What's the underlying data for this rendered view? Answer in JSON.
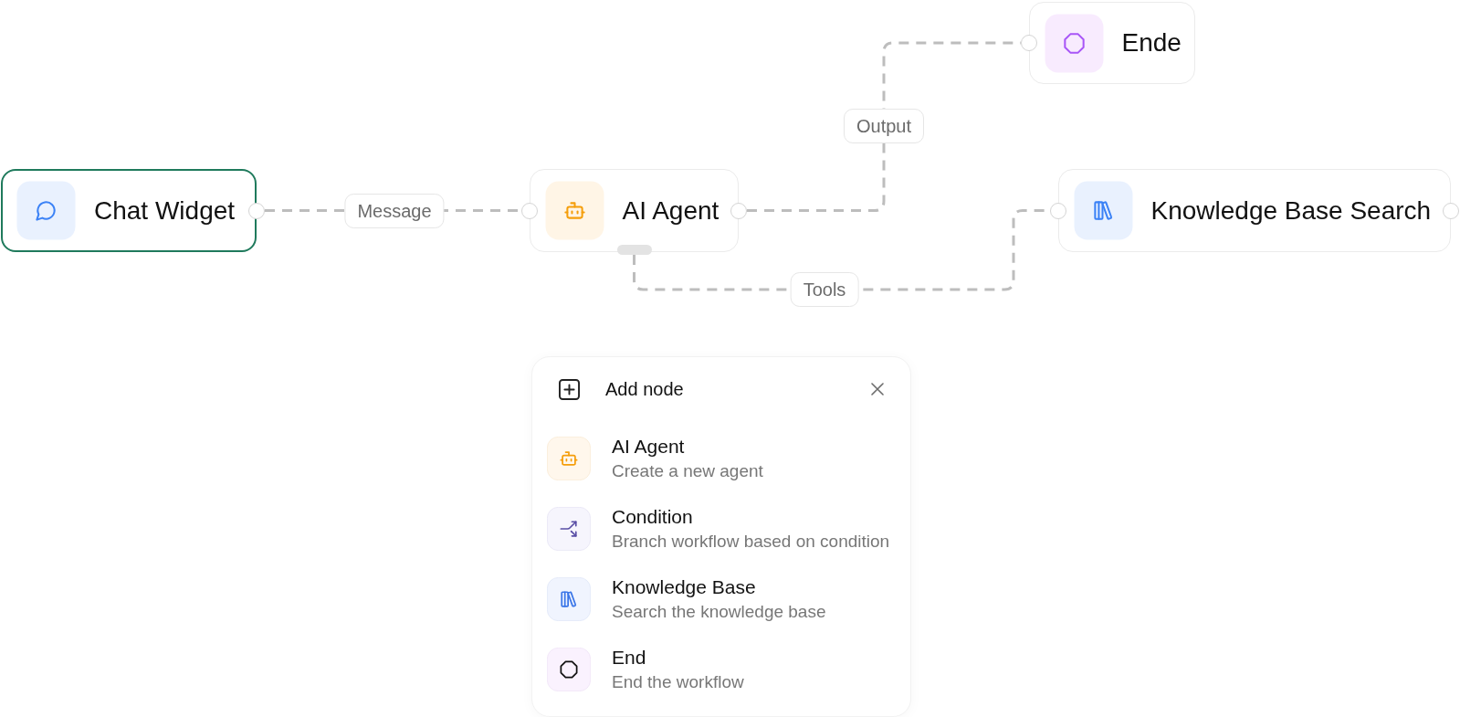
{
  "canvas": {
    "nodes": [
      {
        "kind": "chat",
        "label": "Chat Widget",
        "selected": true
      },
      {
        "kind": "agent",
        "label": "AI Agent",
        "selected": false
      },
      {
        "kind": "end",
        "label": "Ende",
        "selected": false
      },
      {
        "kind": "knowledge",
        "label": "Knowledge Base Search",
        "selected": false
      }
    ],
    "edges": [
      {
        "label": "Message"
      },
      {
        "label": "Output"
      },
      {
        "label": "Tools"
      }
    ]
  },
  "add_node_panel": {
    "title": "Add node",
    "items": [
      {
        "kind": "agent",
        "title": "AI Agent",
        "description": "Create a new agent"
      },
      {
        "kind": "condition",
        "title": "Condition",
        "description": "Branch workflow based on condition"
      },
      {
        "kind": "knowledge",
        "title": "Knowledge Base",
        "description": "Search the knowledge base"
      },
      {
        "kind": "end",
        "title": "End",
        "description": "End the workflow"
      }
    ]
  }
}
